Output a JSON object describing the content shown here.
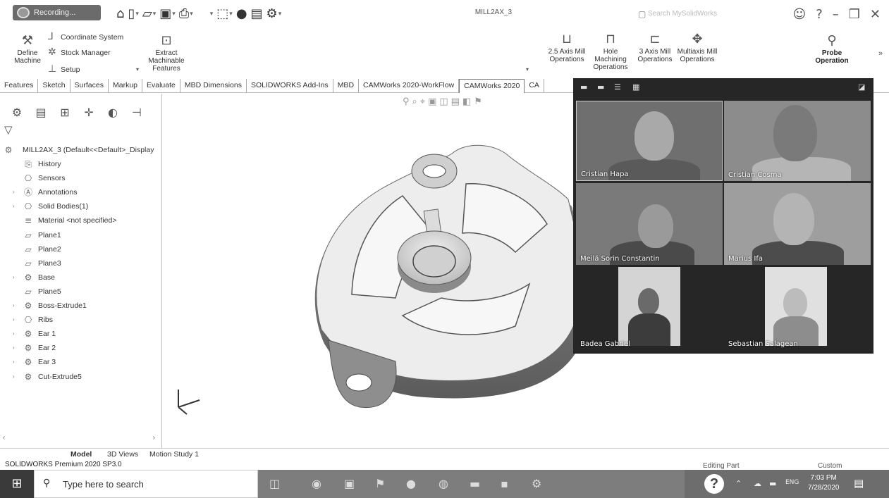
{
  "titlebar": {
    "recording_label": "Recording...",
    "document_title": "MILL2AX_3",
    "search_placeholder": "Search MySolidWorks"
  },
  "ribbon": {
    "define_machine": "Define Machine",
    "coordinate_system": "Coordinate System",
    "stock_manager": "Stock Manager",
    "setup": "Setup",
    "extract_features": "Extract Machinable Features",
    "ops_25axis": "2.5 Axis Mill Operations",
    "hole_machining": "Hole Machining Operations",
    "ops_3axis": "3 Axis Mill Operations",
    "multiaxis": "Multiaxis Mill Operations",
    "probe": "Probe Operation"
  },
  "tabs": [
    "Features",
    "Sketch",
    "Surfaces",
    "Markup",
    "Evaluate",
    "MBD Dimensions",
    "SOLIDWORKS Add-Ins",
    "MBD",
    "CAMWorks 2020-WorkFlow",
    "CAMWorks 2020",
    "CA"
  ],
  "tree": {
    "root": "MILL2AX_3  (Default<<Default>_Display",
    "items": [
      {
        "label": "History",
        "icon": "history-icon",
        "expandable": false
      },
      {
        "label": "Sensors",
        "icon": "sensor-icon",
        "expandable": false
      },
      {
        "label": "Annotations",
        "icon": "annotation-icon",
        "expandable": true
      },
      {
        "label": "Solid Bodies(1)",
        "icon": "solid-bodies-icon",
        "expandable": true
      },
      {
        "label": "Material <not specified>",
        "icon": "material-icon",
        "expandable": false
      },
      {
        "label": "Plane1",
        "icon": "plane-icon",
        "expandable": false
      },
      {
        "label": "Plane2",
        "icon": "plane-icon",
        "expandable": false
      },
      {
        "label": "Plane3",
        "icon": "plane-icon",
        "expandable": false
      },
      {
        "label": "Base",
        "icon": "feature-icon",
        "expandable": true
      },
      {
        "label": "Plane5",
        "icon": "plane-icon",
        "expandable": false
      },
      {
        "label": "Boss-Extrude1",
        "icon": "extrude-icon",
        "expandable": true
      },
      {
        "label": "Ribs",
        "icon": "rib-icon",
        "expandable": true
      },
      {
        "label": "Ear 1",
        "icon": "feature-icon",
        "expandable": true
      },
      {
        "label": "Ear 2",
        "icon": "feature-icon",
        "expandable": true
      },
      {
        "label": "Ear 3",
        "icon": "feature-icon",
        "expandable": true
      },
      {
        "label": "Cut-Extrude5",
        "icon": "cut-extrude-icon",
        "expandable": true
      }
    ]
  },
  "bottom_tabs": [
    "Model",
    "3D Views",
    "Motion Study 1"
  ],
  "status": {
    "product": "SOLIDWORKS Premium 2020 SP3.0",
    "mode": "Editing Part",
    "units": "Custom"
  },
  "meeting": {
    "participants": [
      "Cristian Hapa",
      "Cristian Cosma",
      "Meilă Sorin Constantin",
      "Marius Ifa",
      "Badea Gabriel",
      "Sebastian Salagean"
    ]
  },
  "taskbar": {
    "search_placeholder": "Type here to search",
    "lang": "ENG",
    "time": "7:03 PM",
    "date": "7/28/2020"
  }
}
